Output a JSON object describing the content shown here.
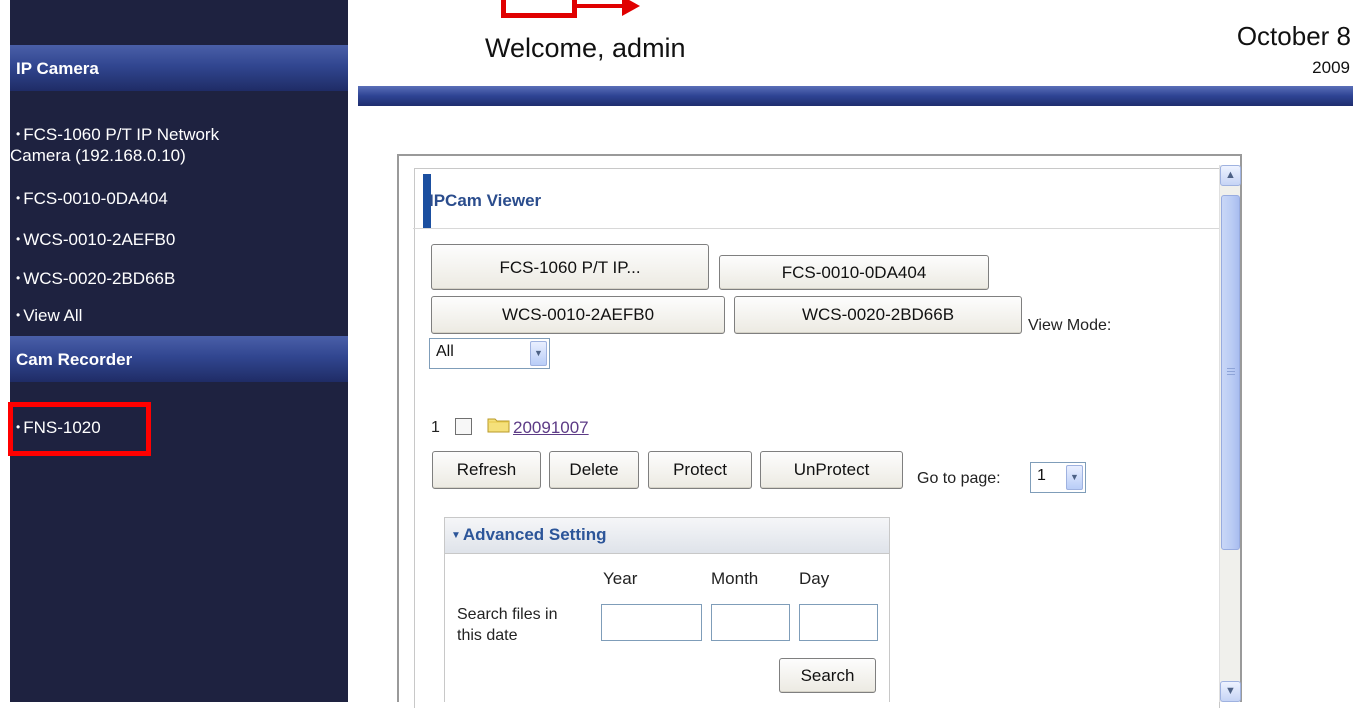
{
  "sidebar": {
    "ip_camera_header": "IP Camera",
    "ip_camera_items": [
      {
        "line1": "FCS-1060 P/T IP Network",
        "line2": "Camera (192.168.0.10)"
      },
      {
        "line1": "FCS-0010-0DA404"
      },
      {
        "line1": "WCS-0010-2AEFB0"
      },
      {
        "line1": "WCS-0020-2BD66B"
      },
      {
        "line1": "View All"
      }
    ],
    "cam_recorder_header": "Cam Recorder",
    "cam_recorder_items": [
      {
        "line1": "FNS-1020"
      }
    ]
  },
  "header": {
    "welcome": "Welcome, admin",
    "month_day": "October 8",
    "year": "2009"
  },
  "viewer": {
    "title": "IPCam Viewer",
    "camera_buttons": [
      "FCS-1060 P/T IP...",
      "FCS-0010-0DA404",
      "WCS-0010-2AEFB0",
      "WCS-0020-2BD66B"
    ],
    "view_mode_label": "View Mode:",
    "view_mode_value": "All",
    "row_number": "1",
    "folder_link": "20091007",
    "actions": [
      "Refresh",
      "Delete",
      "Protect",
      "UnProtect"
    ],
    "goto_label": "Go to page:",
    "goto_value": "1"
  },
  "advanced": {
    "title": "Advanced Setting",
    "year_label": "Year",
    "month_label": "Month",
    "day_label": "Day",
    "search_label_line1": "Search files in",
    "search_label_line2": "this date",
    "search_button": "Search"
  },
  "colors": {
    "sidebar_bg": "#1e2240",
    "header_bar": "#2e4393",
    "highlight_red": "#ff0000",
    "title_blue": "#2b4d8d",
    "link_purple": "#5d3b86"
  },
  "icons": [
    "folder-icon",
    "scroll-up-icon",
    "scroll-down-icon",
    "dropdown-arrow-icon",
    "collapse-triangle-icon",
    "bullet-icon"
  ]
}
